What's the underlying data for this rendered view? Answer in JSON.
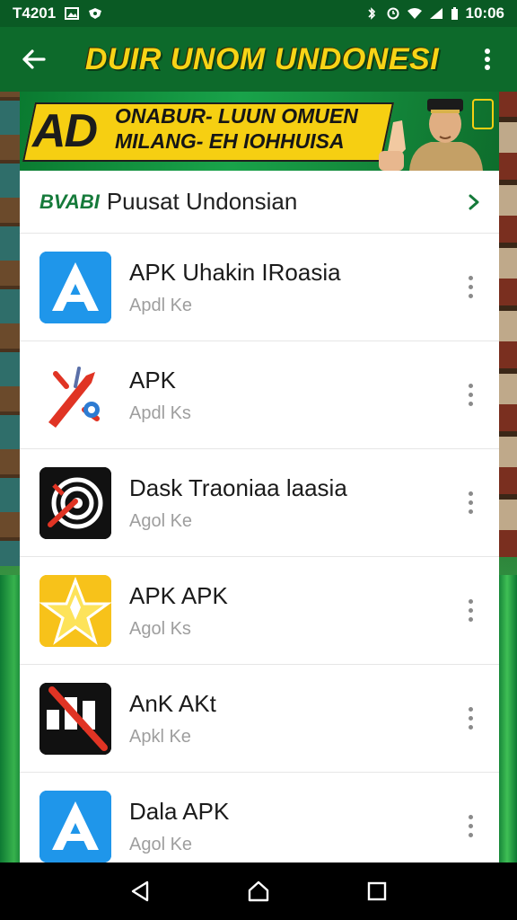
{
  "status_bar": {
    "left_text": "T4201",
    "time": "10:06"
  },
  "app_bar": {
    "title": "DUIR UNOM UNDONESI"
  },
  "banner": {
    "big_text": "AD",
    "line1": "ONABUR- LUUN OMUEN",
    "line2": "MILANG- EH IOHHUISA"
  },
  "section": {
    "tag": "BVABI",
    "label": "Puusat Undonsian"
  },
  "apps": [
    {
      "name": "APK Uhakin IRoasia",
      "sub": "Apdl Ke",
      "icon": "blue-a-icon"
    },
    {
      "name": "APK",
      "sub": "Apdl Ks",
      "icon": "red-rocket-icon"
    },
    {
      "name": "Dask Traoniaa laasia",
      "sub": "Agol Ke",
      "icon": "target-icon"
    },
    {
      "name": "APK APK",
      "sub": "Agol Ks",
      "icon": "yellow-star-icon"
    },
    {
      "name": "AnK AKt",
      "sub": "Apkl Ke",
      "icon": "slash-blocks-icon"
    },
    {
      "name": "Dala APK",
      "sub": "Agol Ke",
      "icon": "blue-a-icon"
    }
  ],
  "colors": {
    "primary_green": "#0d6a2b",
    "title_yellow": "#f7d417",
    "accent_green": "#157a3a"
  }
}
